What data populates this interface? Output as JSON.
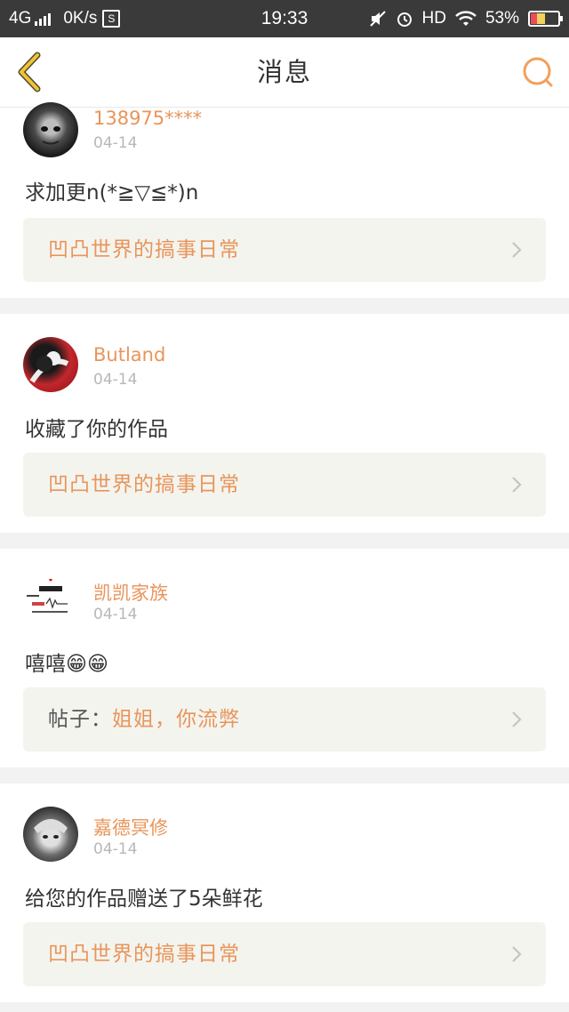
{
  "status_bar": {
    "network": "4G",
    "speed": "0K/s",
    "speed_badge": "S",
    "time": "19:33",
    "hd": "HD",
    "battery": "53%"
  },
  "header": {
    "title": "消息",
    "back_icon": "chevron-left-icon",
    "search_icon": "search-icon"
  },
  "accent_color": "#e8955a",
  "messages": [
    {
      "user": "138975****",
      "date": "04-14",
      "text": "求加更n(*≧▽≦*)n",
      "link_prefix": "",
      "link": "凹凸世界的搞事日常"
    },
    {
      "user": "Butland",
      "date": "04-14",
      "text": "收藏了你的作品",
      "link_prefix": "",
      "link": "凹凸世界的搞事日常"
    },
    {
      "user": "凯凯家族",
      "date": "04-14",
      "text": "嘻嘻😁😁",
      "link_prefix": "帖子：",
      "link": "姐姐，你流弊"
    },
    {
      "user": "嘉德冥修",
      "date": "04-14",
      "text": "给您的作品赠送了5朵鲜花",
      "link_prefix": "",
      "link": "凹凸世界的搞事日常"
    }
  ]
}
